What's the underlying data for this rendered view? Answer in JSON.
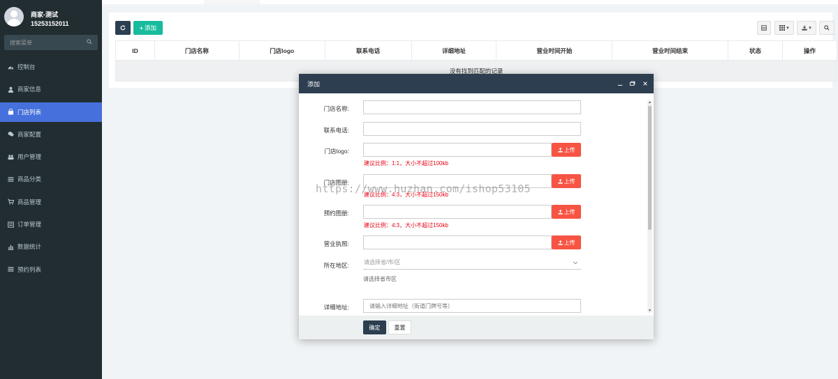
{
  "user": {
    "name": "商家-测试",
    "phone": "15253152011"
  },
  "sidebar": {
    "search_placeholder": "搜索菜单",
    "items": [
      {
        "label": "控制台",
        "icon": "dashboard-icon",
        "active": false
      },
      {
        "label": "商家信息",
        "icon": "user-icon",
        "active": false
      },
      {
        "label": "门店列表",
        "icon": "shopping-bag-icon",
        "active": true
      },
      {
        "label": "商家配置",
        "icon": "chat-icon",
        "active": false
      },
      {
        "label": "用户管理",
        "icon": "users-icon",
        "active": false
      },
      {
        "label": "商品分类",
        "icon": "list-icon",
        "active": false
      },
      {
        "label": "商品管理",
        "icon": "cart-icon",
        "active": false
      },
      {
        "label": "订单管理",
        "icon": "order-icon",
        "active": false
      },
      {
        "label": "数据统计",
        "icon": "bar-chart-icon",
        "active": false
      },
      {
        "label": "预约列表",
        "icon": "list-icon",
        "active": false
      }
    ]
  },
  "toolbar": {
    "add_label": "添加"
  },
  "table": {
    "columns": [
      "ID",
      "门店名称",
      "门店logo",
      "联系电话",
      "详细地址",
      "营业时间开始",
      "营业时间结束",
      "状态",
      "操作"
    ],
    "empty_text": "没有找到匹配的记录"
  },
  "modal": {
    "title": "添加",
    "fields": {
      "store_name": {
        "label": "门店名称:"
      },
      "phone": {
        "label": "联系电话:"
      },
      "logo": {
        "label": "门店logo:",
        "hint": "建议比例：1:1，大小不超过100kb"
      },
      "album": {
        "label": "门店图册:",
        "hint": "建议比例：4:3，大小不超过150kb"
      },
      "booking_album": {
        "label": "预约图册:",
        "hint": "建议比例：4:3，大小不超过150kb"
      },
      "license": {
        "label": "营业执照:"
      },
      "region": {
        "label": "所在地区:",
        "placeholder": "请选择省/市/区",
        "help": "请选择省市区"
      },
      "address": {
        "label": "详细地址:",
        "placeholder": "请输入详细地址（街道门牌号等）"
      }
    },
    "upload_label": "上传",
    "ok_label": "确定",
    "reset_label": "重置"
  },
  "watermark": "https://www.huzhan.com/ishop53105",
  "colors": {
    "sidebar_bg": "#222d32",
    "active_menu": "#4670db",
    "primary": "#2c3e50",
    "success": "#18bc9c",
    "danger": "#f75444",
    "hint_red": "#e60012"
  }
}
